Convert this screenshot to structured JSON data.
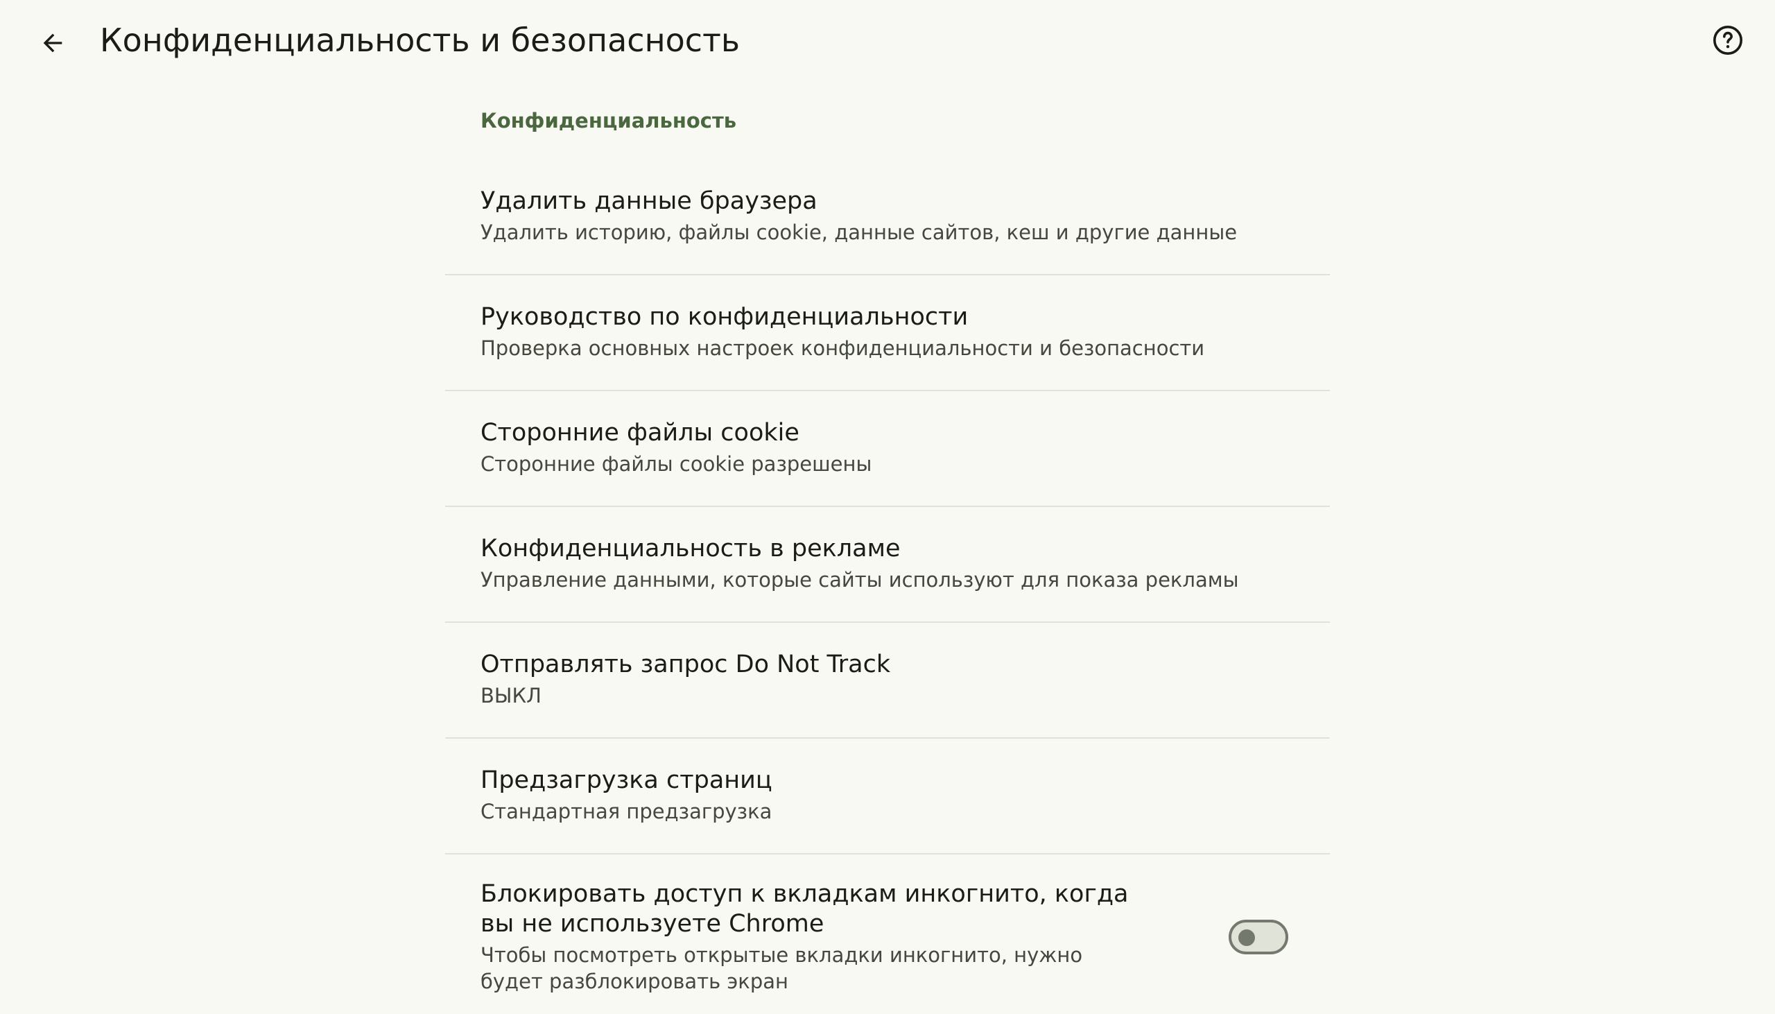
{
  "header": {
    "title": "Конфиденциальность и безопасность",
    "back_icon": "arrow-back-icon",
    "help_icon": "help-circle-icon"
  },
  "section": {
    "title": "Конфиденциальность"
  },
  "items": [
    {
      "title": "Удалить данные браузера",
      "summary": "Удалить историю, файлы cookie, данные сайтов, кеш и другие данные"
    },
    {
      "title": "Руководство по конфиденциальности",
      "summary": "Проверка основных настроек конфиденциальности и безопасности"
    },
    {
      "title": "Сторонние файлы cookie",
      "summary": "Сторонние файлы cookie разрешены"
    },
    {
      "title": "Конфиденциальность в рекламе",
      "summary": "Управление данными, которые сайты используют для показа рекламы"
    },
    {
      "title": "Отправлять запрос Do Not Track",
      "summary": "ВЫКЛ"
    },
    {
      "title": "Предзагрузка страниц",
      "summary": "Стандартная предзагрузка"
    }
  ],
  "toggle_item": {
    "title": "Блокировать доступ к вкладкам инкогнито, когда вы не используете Chrome",
    "summary": "Чтобы посмотреть открытые вкладки инкогнито, нужно будет разблокировать экран",
    "checked": false
  },
  "colors": {
    "background": "#f8f9f2",
    "section_accent": "#4a6740",
    "divider": "#dfe2d9",
    "switch_outline": "#74796e"
  }
}
